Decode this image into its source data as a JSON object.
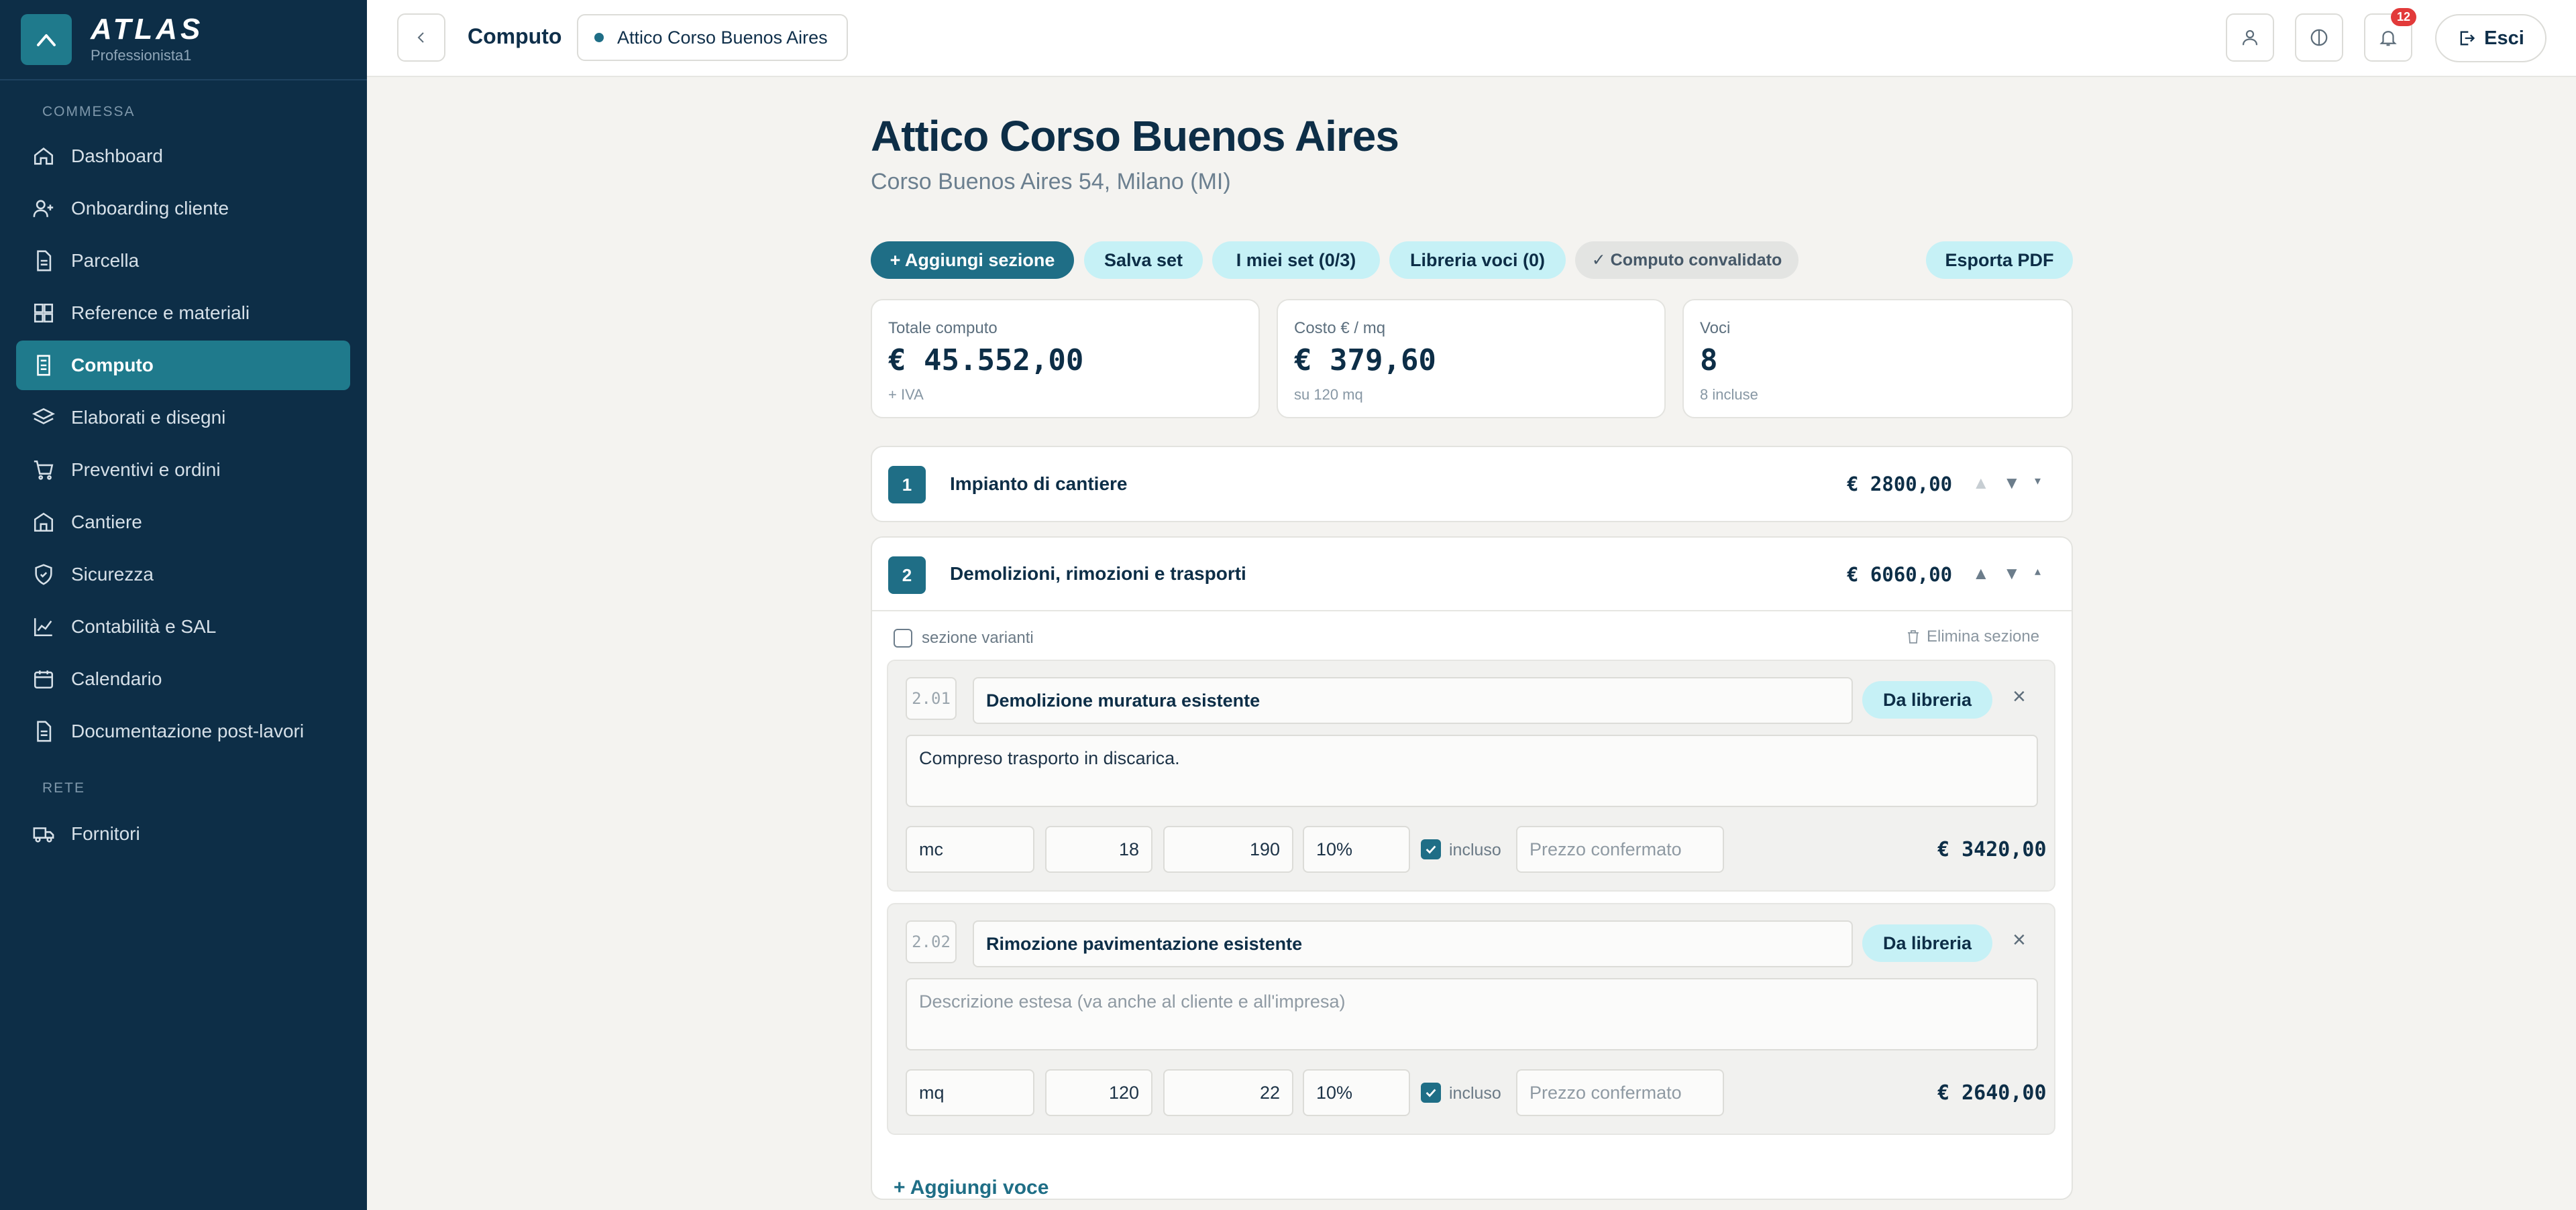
{
  "brand": {
    "name": "ATLAS",
    "subtitle": "Professionista1"
  },
  "sidebar": {
    "section_commessa": "COMMESSA",
    "section_rete": "RETE",
    "items": [
      {
        "label": "Dashboard",
        "icon": "home-icon"
      },
      {
        "label": "Onboarding cliente",
        "icon": "user-plus-icon"
      },
      {
        "label": "Parcella",
        "icon": "document-icon"
      },
      {
        "label": "Reference e materiali",
        "icon": "grid-icon"
      },
      {
        "label": "Computo",
        "icon": "document-icon",
        "active": true
      },
      {
        "label": "Elaborati e disegni",
        "icon": "layers-icon"
      },
      {
        "label": "Preventivi e ordini",
        "icon": "cart-icon"
      },
      {
        "label": "Cantiere",
        "icon": "building-icon"
      },
      {
        "label": "Sicurezza",
        "icon": "shield-icon"
      },
      {
        "label": "Contabilità e SAL",
        "icon": "chart-line-icon"
      },
      {
        "label": "Calendario",
        "icon": "calendar-icon"
      },
      {
        "label": "Documentazione post-lavori",
        "icon": "document-icon"
      }
    ],
    "rete_items": [
      {
        "label": "Fornitori",
        "icon": "truck-icon"
      }
    ]
  },
  "topbar": {
    "title": "Computo",
    "project": "Attico Corso Buenos Aires",
    "notifications_count": "12",
    "logout_label": "Esci"
  },
  "page": {
    "title": "Attico Corso Buenos Aires",
    "address": "Corso Buenos Aires 54, Milano (MI)"
  },
  "toolbar": {
    "add_section": "+ Aggiungi sezione",
    "save_set": "Salva set",
    "my_sets": "I miei set (0/3)",
    "library": "Libreria voci (0)",
    "validated": "✓ Computo convalidato",
    "export_pdf": "Esporta PDF"
  },
  "stats": {
    "total_label": "Totale computo",
    "total_value": "€ 45.552,00",
    "total_note": "+ IVA",
    "cost_label": "Costo € / mq",
    "cost_value": "€ 379,60",
    "cost_note": "su 120 mq",
    "items_label": "Voci",
    "items_value": "8",
    "items_note": "8 incluse"
  },
  "sections": [
    {
      "number": "1",
      "title": "Impianto di cantiere",
      "total": "€ 2800,00"
    },
    {
      "number": "2",
      "title": "Demolizioni, rimozioni e trasporti",
      "total": "€ 6060,00",
      "variants_label": "sezione varianti",
      "delete_label": "Elimina sezione",
      "items": [
        {
          "code": "2.01",
          "name": "Demolizione muratura esistente",
          "source": "Da libreria",
          "description": "Compreso trasporto in discarica.",
          "unit": "mc",
          "qty": "18",
          "price": "190",
          "discount": "10%",
          "included_label": "incluso",
          "status_placeholder": "Prezzo confermato",
          "total": "€ 3420,00"
        },
        {
          "code": "2.02",
          "name": "Rimozione pavimentazione esistente",
          "source": "Da libreria",
          "description_placeholder": "Descrizione estesa (va anche al cliente e all'impresa)",
          "unit": "mq",
          "qty": "120",
          "price": "22",
          "discount": "10%",
          "included_label": "incluso",
          "status_placeholder": "Prezzo confermato",
          "total": "€ 2640,00"
        }
      ],
      "add_item_label": "+ Aggiungi voce"
    }
  ],
  "colors": {
    "sidebar_bg": "#0d2e47",
    "accent": "#1f6e86",
    "chip_light": "#c6f1f6",
    "badge": "#e23a3a"
  }
}
